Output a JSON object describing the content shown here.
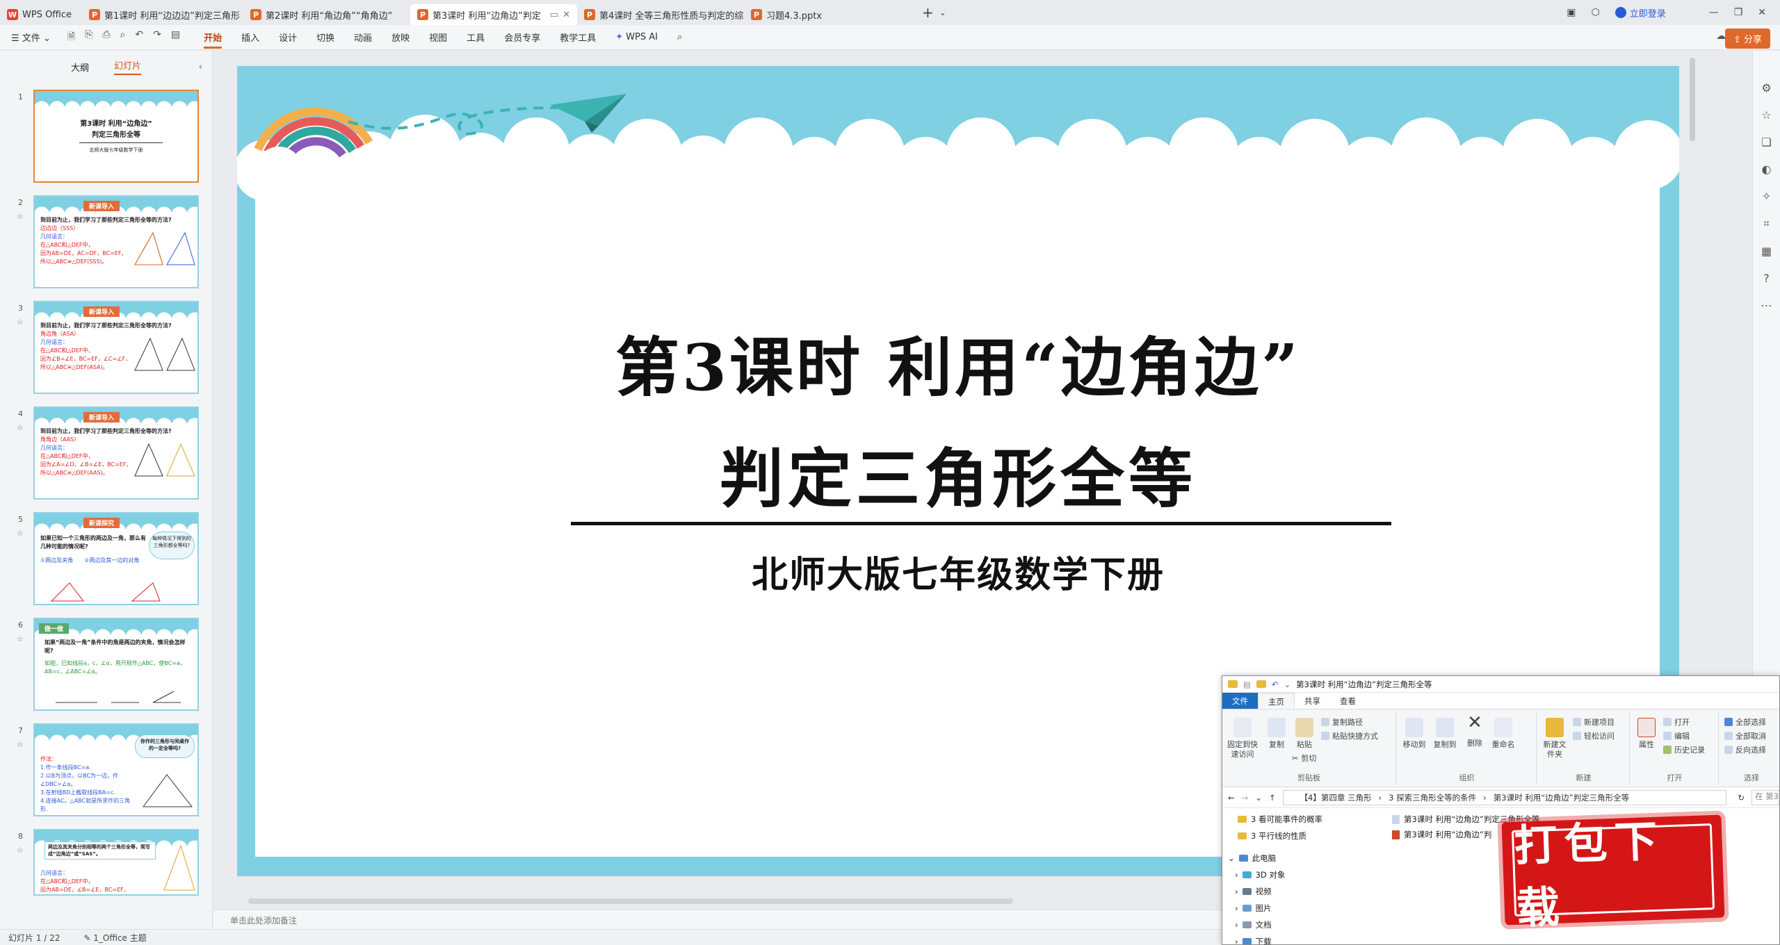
{
  "tabbar": {
    "tabs": [
      {
        "label": "WPS Office",
        "icon": "wps-logo-icon"
      },
      {
        "label": "第1课时 利用“边边边”判定三角形",
        "icon": "ppt-file-icon"
      },
      {
        "label": "第2课时 利用“角边角”“角角边”",
        "icon": "ppt-file-icon"
      },
      {
        "label": "第3课时 利用“边角边”判定",
        "icon": "ppt-file-icon"
      },
      {
        "label": "第4课时 全等三角形性质与判定的综",
        "icon": "ppt-file-icon"
      },
      {
        "label": "习题4.3.pptx",
        "icon": "ppt-file-icon"
      }
    ],
    "login_label": "立即登录"
  },
  "menubar": {
    "file_label": "文件",
    "items": [
      "开始",
      "插入",
      "设计",
      "切换",
      "动画",
      "放映",
      "视图",
      "工具",
      "会员专享",
      "教学工具"
    ],
    "wps_ai_label": "WPS AI",
    "share_label": "分享"
  },
  "leftpanel": {
    "tab_outline": "大纲",
    "tab_slides": "幻灯片",
    "slides": [
      {
        "num": "1",
        "title": "第3课时 利用“边角边”",
        "title2": "判定三角形全等",
        "sub": "北师大版七年级数学下册"
      },
      {
        "num": "2",
        "tag": "新课导入",
        "q": "到目前为止，我们学习了那些判定三角形全等的方法?",
        "l1": "边边边（SSS）",
        "l2": "几何语言：",
        "l3": "在△ABC和△DEF中，",
        "l4": "因为AB=DE，AC=DF，BC=EF，",
        "l5": "所以△ABC≌△DEF(SSS)。"
      },
      {
        "num": "3",
        "tag": "新课导入",
        "q": "到目前为止，我们学习了那些判定三角形全等的方法?",
        "l1": "角边角（ASA）",
        "l2": "几何语言：",
        "l3": "在△ABC和△DEF中，",
        "l4": "因为∠B=∠E，BC=EF，∠C=∠F，",
        "l5": "所以△ABC≌△DEF(ASA)。"
      },
      {
        "num": "4",
        "tag": "新课导入",
        "q": "到目前为止，我们学习了那些判定三角形全等的方法?",
        "l1": "角角边（AAS）",
        "l2": "几何语言：",
        "l3": "在△ABC和△DEF中，",
        "l4": "因为∠A=∠D，∠B=∠E，BC=EF，",
        "l5": "所以△ABC≌△DEF(AAS)。"
      },
      {
        "num": "5",
        "tag": "新课探究",
        "q": "如果已知一个三角形的两边及一角，那么有几种可能的情况呢?",
        "l1": "①两边及夹角",
        "l2": "②两边及其一边的对角",
        "bubble": "每种情况下得到的三角形都全等吗?"
      },
      {
        "num": "6",
        "tag": "做一做",
        "q": "如果“两边及一角”条件中的角是两边的夹角，情况会怎样呢?",
        "l1": "如图，已知线段a，c，∠α，用尺规作△ABC，使BC=a，AB=c，∠ABC=∠α。"
      },
      {
        "num": "7",
        "q": "你作的三角形与同桌作的一定全等吗?",
        "l1": "作法：",
        "l2": "1.作一条线段BC=a.",
        "l3": "2.以B为顶点，以BC为一边，作∠DBC=∠α。",
        "l4": "3.在射线BD上截取线段BA=c.",
        "l5": "4.连接AC。△ABC就是所求作的三角形."
      },
      {
        "num": "8",
        "q": "两边及其夹角分别相等的两个三角形全等，简写成“边角边”或“SAS”。",
        "l1": "几何语言：",
        "l2": "在△ABC和△DEF中，",
        "l3": "因为AB=DE，∠B=∠E，BC=EF，"
      }
    ]
  },
  "slide": {
    "title_line1": "第3课时  利用“边角边”",
    "title_line2": "判定三角形全等",
    "subtitle": "北师大版七年级数学下册",
    "colors": {
      "sky": "#7fd0e2",
      "paper": "#ffffff"
    }
  },
  "notes": {
    "placeholder": "单击此处添加备注"
  },
  "statusbar": {
    "slide_counter": "幻灯片 1 / 22",
    "theme": "1_Office 主题"
  },
  "explorer": {
    "title": "第3课时 利用“边角边”判定三角形全等",
    "tabs": [
      "文件",
      "主页",
      "共享",
      "查看"
    ],
    "ribbon": {
      "pin_label": "固定到快速访问",
      "copy_label": "复制",
      "paste_label": "粘贴",
      "copy_path_label": "复制路径",
      "paste_shortcut_label": "粘贴快捷方式",
      "cut_label": "剪切",
      "group_clipboard": "剪贴板",
      "move_to_label": "移动到",
      "copy_to_label": "复制到",
      "delete_label": "删除",
      "rename_label": "重命名",
      "group_organize": "组织",
      "new_folder_label": "新建文件夹",
      "new_item_label": "新建项目",
      "easy_access_label": "轻松访问",
      "group_new": "新建",
      "properties_label": "属性",
      "open_label": "打开",
      "edit_label": "编辑",
      "history_label": "历史记录",
      "group_open": "打开",
      "select_all_label": "全部选择",
      "select_none_label": "全部取消",
      "invert_label": "反向选择",
      "group_select": "选择"
    },
    "address": {
      "crumb1": "【4】第四章 三角形",
      "crumb2": "3 探索三角形全等的条件",
      "crumb3": "第3课时 利用“边角边”判定三角形全等",
      "search_placeholder": "在 第3"
    },
    "tree": [
      {
        "label": "3 看可能事件的概率"
      },
      {
        "label": "3 平行线的性质"
      },
      {
        "label": "此电脑"
      },
      {
        "label": "3D 对象"
      },
      {
        "label": "视频"
      },
      {
        "label": "图片"
      },
      {
        "label": "文档"
      },
      {
        "label": "下载"
      }
    ],
    "files": [
      {
        "label": "第3课时  利用“边角边”判定三角形全等"
      },
      {
        "label": "第3课时 利用“边角边”判"
      }
    ]
  },
  "stamp": {
    "text": "打包下载"
  }
}
